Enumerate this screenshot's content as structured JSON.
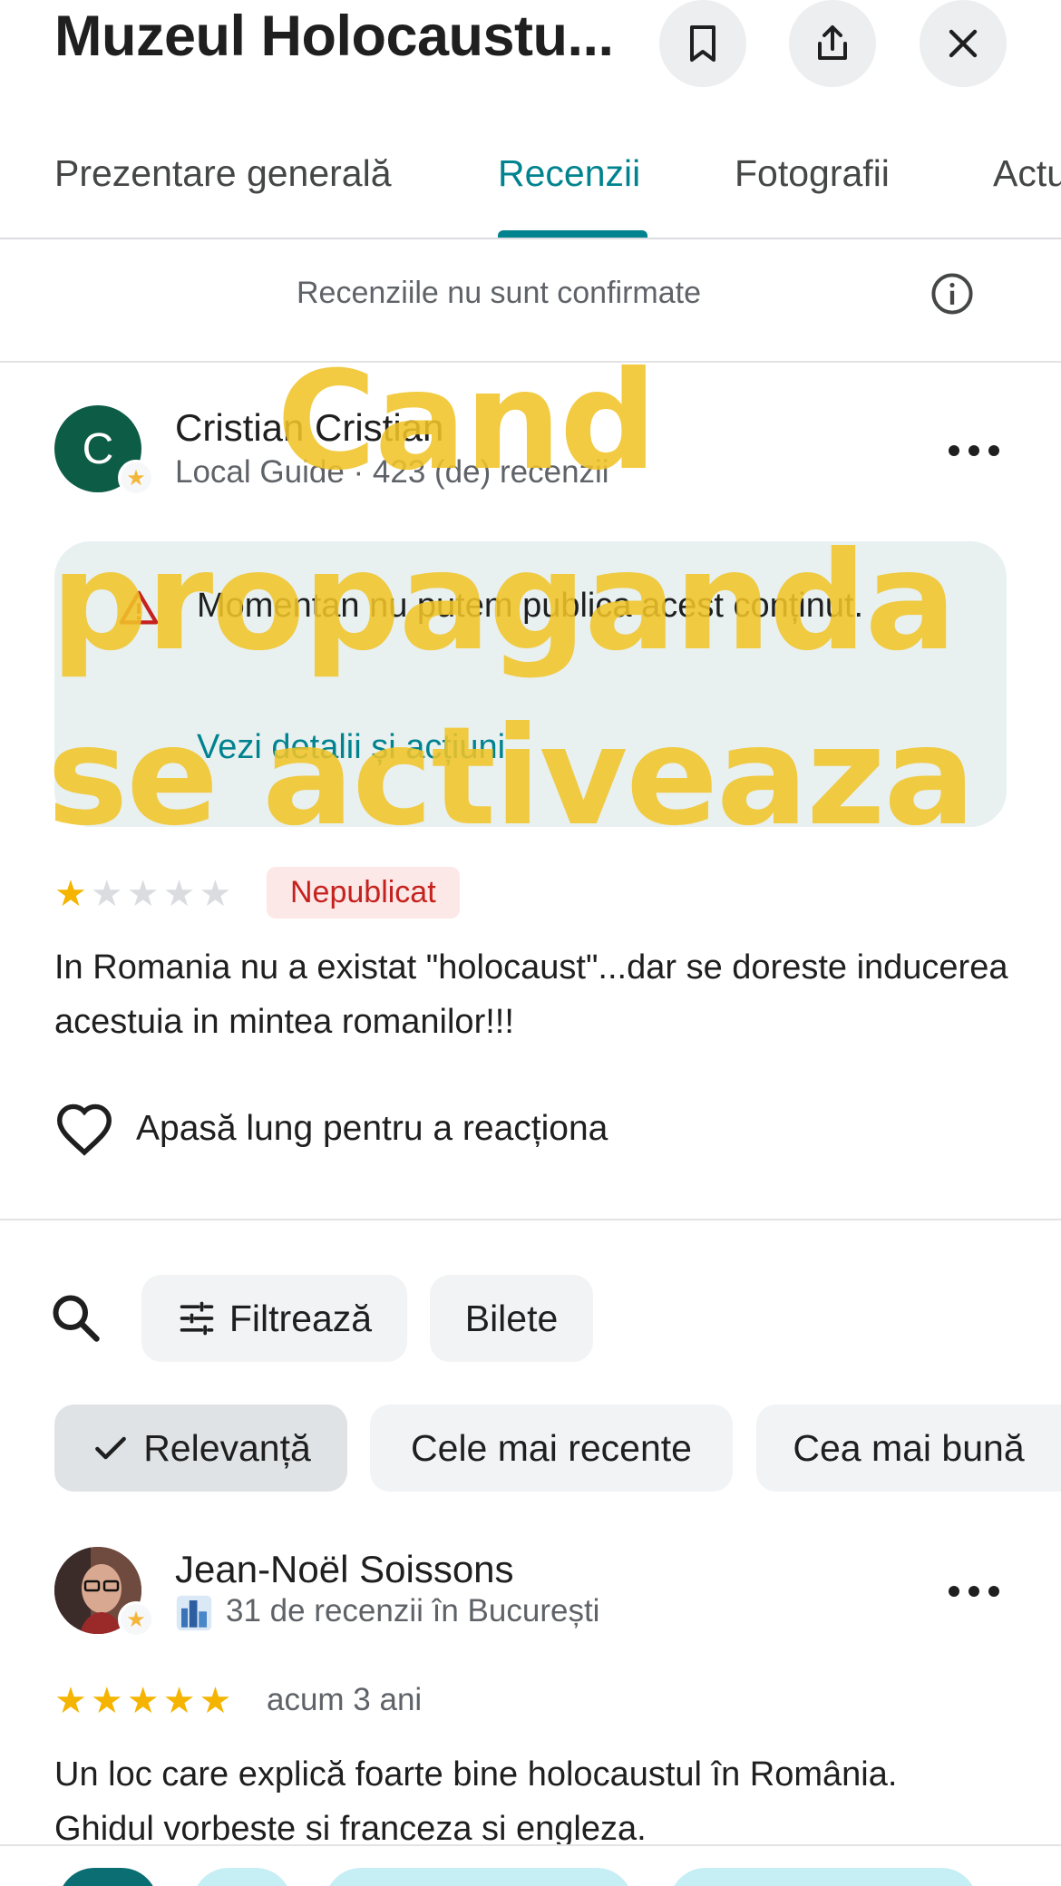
{
  "header": {
    "title": "Muzeul Holocaustu...",
    "icons": [
      "bookmark-icon",
      "share-icon",
      "close-icon"
    ]
  },
  "tabs": [
    "Prezentare generală",
    "Recenzii",
    "Fotografii",
    "Actu"
  ],
  "active_tab": "Recenzii",
  "notice": {
    "text": "Recenziile nu sunt confirmate"
  },
  "review1": {
    "avatar_letter": "C",
    "name": "Cristian Cristian",
    "subtitle": "Local Guide · 423 (de) recenzii",
    "warning_text": "Momentan nu putem publica acest conținut.",
    "warning_link": "Vezi detalii și acțiuni",
    "rating": 1,
    "status_badge": "Nepublicat",
    "text": "In Romania nu a existat \"holocaust\"...dar se doreste inducerea acestuia in mintea romanilor!!!",
    "react_label": "Apasă lung pentru a reacționa"
  },
  "filters": {
    "filter_label": "Filtrează",
    "tickets_label": "Bilete",
    "sort_options": [
      "Relevanță",
      "Cele mai recente",
      "Cea mai bună"
    ],
    "selected_sort": "Relevanță"
  },
  "review2": {
    "name": "Jean-Noël Soissons",
    "subtitle": "31 de recenzii în București",
    "rating": 5,
    "time": "acum 3 ani",
    "text": "Un loc care explică foarte bine holocaustul în România. Ghidul vorbeste si franceza si engleza."
  },
  "overlay": {
    "lines": [
      "Cand",
      "propaganda",
      "se activeaza"
    ]
  },
  "colors": {
    "accent": "#00838f",
    "overlay": "#f0c428",
    "badge_red": "#c5221f",
    "star": "#f4b400"
  }
}
